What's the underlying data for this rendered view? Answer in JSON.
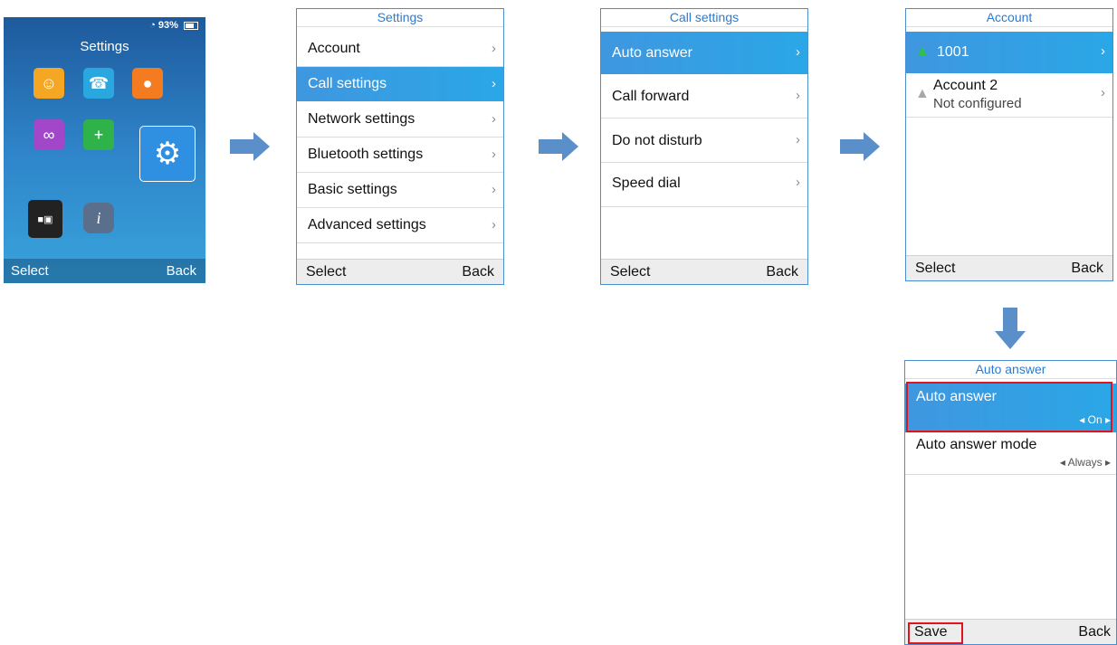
{
  "home": {
    "status_text": "93%",
    "title": "Settings",
    "select": "Select",
    "back": "Back",
    "icons": [
      "contacts-icon",
      "call-history-icon",
      "messages-icon",
      "voicemail-icon",
      "security-icon",
      "settings-gear-icon",
      "multi-app-icon",
      "info-icon"
    ]
  },
  "settings": {
    "header": "Settings",
    "items": [
      "Account",
      "Call settings",
      "Network settings",
      "Bluetooth settings",
      "Basic settings",
      "Advanced settings"
    ],
    "select": "Select",
    "back": "Back"
  },
  "call_settings": {
    "header": "Call settings",
    "items": [
      "Auto answer",
      "Call forward",
      "Do not disturb",
      "Speed dial"
    ],
    "select": "Select",
    "back": "Back"
  },
  "account": {
    "header": "Account",
    "items": [
      {
        "label": "1001"
      },
      {
        "label": "Account 2",
        "sub": "Not configured"
      }
    ],
    "select": "Select",
    "back": "Back"
  },
  "auto_answer": {
    "header": "Auto answer",
    "items": [
      {
        "label": "Auto answer",
        "value": "On"
      },
      {
        "label": "Auto answer mode",
        "value": "Always"
      }
    ],
    "save": "Save",
    "back": "Back"
  },
  "colors": {
    "accent": "#2a7bd1",
    "highlight": "#e0141e"
  }
}
